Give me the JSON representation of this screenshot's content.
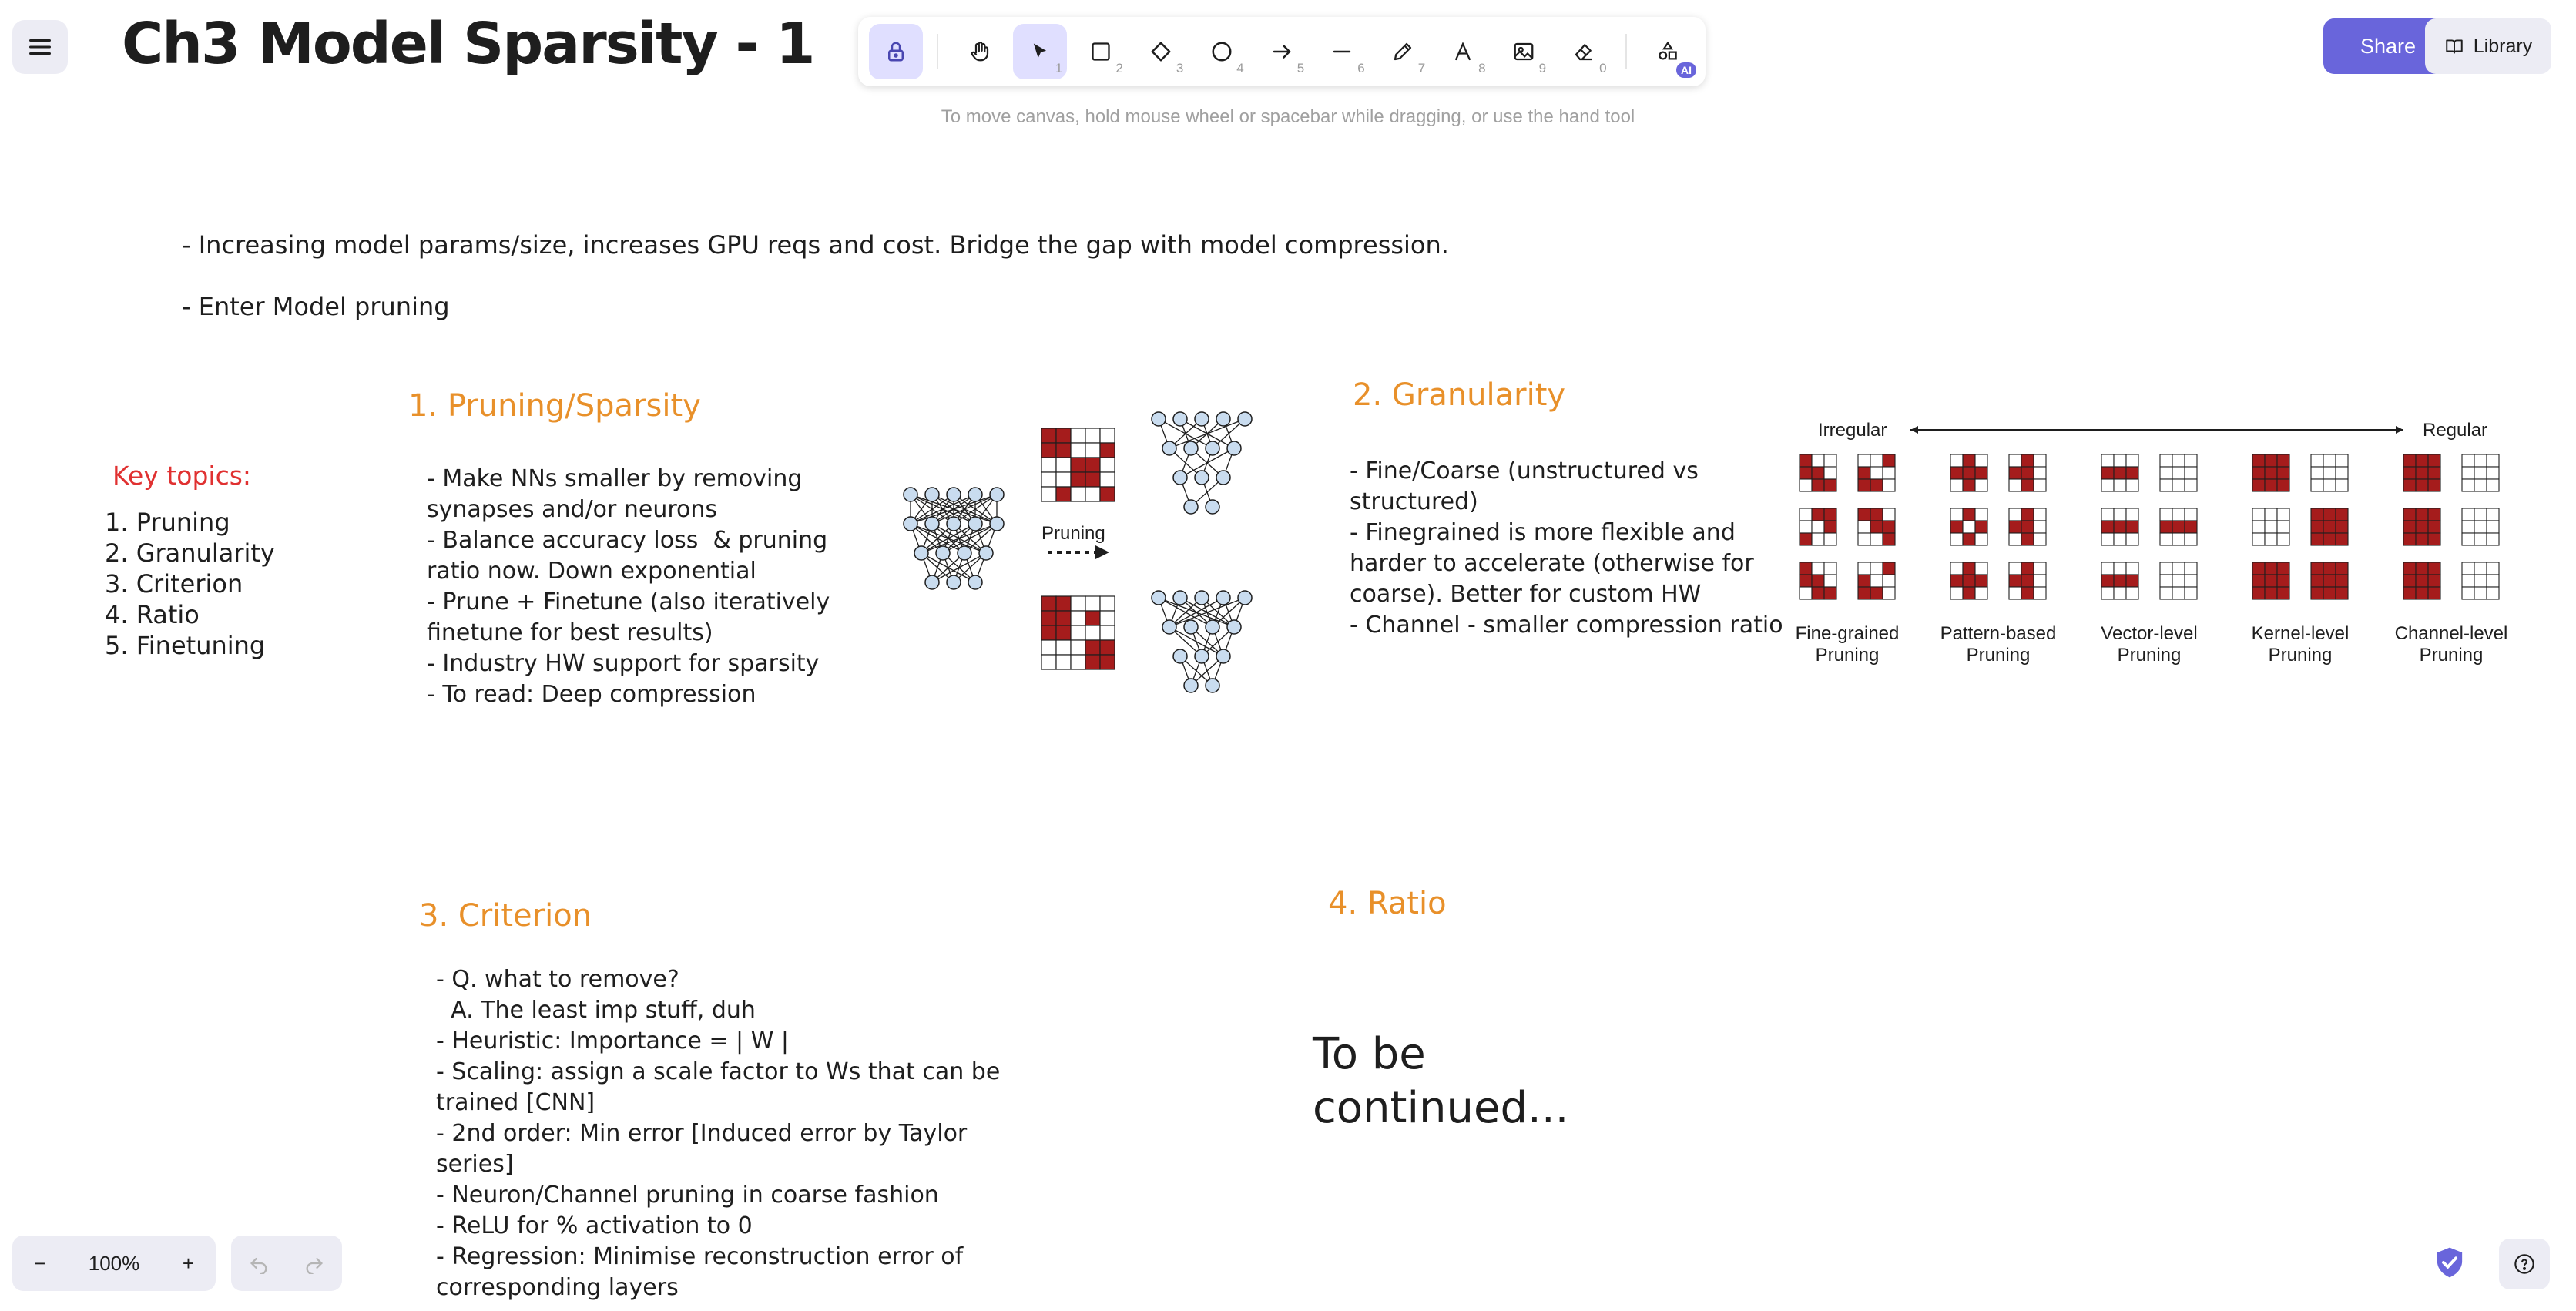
{
  "header": {
    "menu_icon": "hamburger-icon",
    "title": "Ch3 Model Sparsity - 1",
    "share_label": "Share",
    "library_label": "Library"
  },
  "toolbar": {
    "tools": [
      {
        "name": "lock",
        "icon": "lock-icon",
        "key": ""
      },
      {
        "name": "hand",
        "icon": "hand-icon",
        "key": ""
      },
      {
        "name": "selection",
        "icon": "pointer-icon",
        "key": "1"
      },
      {
        "name": "rectangle",
        "icon": "rectangle-icon",
        "key": "2"
      },
      {
        "name": "diamond",
        "icon": "diamond-icon",
        "key": "3"
      },
      {
        "name": "ellipse",
        "icon": "ellipse-icon",
        "key": "4"
      },
      {
        "name": "arrow",
        "icon": "arrow-icon",
        "key": "5"
      },
      {
        "name": "line",
        "icon": "line-icon",
        "key": "6"
      },
      {
        "name": "draw",
        "icon": "pencil-icon",
        "key": "7"
      },
      {
        "name": "text",
        "icon": "text-icon",
        "key": "8"
      },
      {
        "name": "image",
        "icon": "image-icon",
        "key": "9"
      },
      {
        "name": "eraser",
        "icon": "eraser-icon",
        "key": "0"
      },
      {
        "name": "more",
        "icon": "shapes-icon",
        "key": ""
      }
    ],
    "ai_badge": "AI",
    "hint": "To move canvas, hold mouse wheel or spacebar while dragging, or use the hand tool"
  },
  "canvas": {
    "intro_line_1": "- Increasing model params/size, increases GPU reqs and cost. Bridge the gap with model compression.",
    "intro_line_2": "- Enter Model pruning",
    "key_topics": {
      "title": "Key topics:",
      "items": [
        "1. Pruning",
        "2. Granularity",
        "3. Criterion",
        "4. Ratio",
        "5. Finetuning"
      ]
    },
    "section1": {
      "heading": "1. Pruning/Sparsity",
      "body": "- Make NNs smaller by removing\nsynapses and/or neurons\n- Balance accuracy loss  & pruning\nratio now. Down exponential\n- Prune + Finetune (also iteratively\nfinetune for best results)\n- Industry HW support for sparsity\n- To read: Deep compression",
      "figure_label": "Pruning"
    },
    "section2": {
      "heading": "2. Granularity",
      "body": "- Fine/Coarse (unstructured vs\nstructured)\n- Finegrained is more flexible and\nharder to accelerate (otherwise for\ncoarse). Better for custom HW\n- Channel - smaller compression ratio",
      "axis_left": "Irregular",
      "axis_right": "Regular",
      "categories": [
        {
          "line1": "Fine-grained",
          "line2": "Pruning"
        },
        {
          "line1": "Pattern-based",
          "line2": "Pruning"
        },
        {
          "line1": "Vector-level",
          "line2": "Pruning"
        },
        {
          "line1": "Kernel-level",
          "line2": "Pruning"
        },
        {
          "line1": "Channel-level",
          "line2": "Pruning"
        }
      ]
    },
    "section3": {
      "heading": "3. Criterion",
      "body": "- Q. what to remove?\n  A. The least imp stuff, duh\n- Heuristic: Importance = | W |\n- Scaling: assign a scale factor to Ws that can be\ntrained [CNN]\n- 2nd order: Min error [Induced error by Taylor\nseries]\n- Neuron/Channel pruning in coarse fashion\n- ReLU for % activation to 0\n- Regression: Minimise reconstruction error of\ncorresponding layers"
    },
    "section4": {
      "heading": "4. Ratio",
      "body": "To be\ncontinued..."
    }
  },
  "footer": {
    "zoom_out": "−",
    "zoom_level": "100%",
    "zoom_in": "+",
    "undo_icon": "undo-icon",
    "redo_icon": "redo-icon",
    "shield_icon": "shield-check-icon",
    "help_icon": "help-icon"
  },
  "colors": {
    "accent": "#6965db",
    "heading_orange": "#e8902a",
    "key_red": "#e03131",
    "prune_red": "#a51c1c",
    "node_fill": "#c9dcef"
  }
}
